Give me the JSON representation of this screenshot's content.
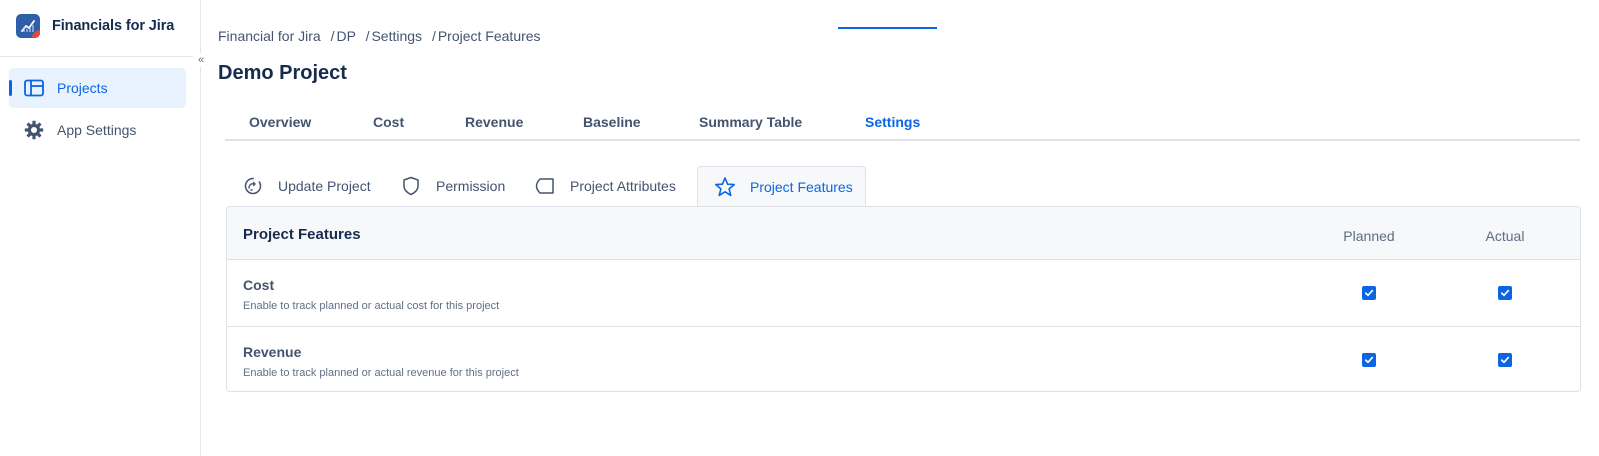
{
  "app": {
    "name": "Financials for Jira",
    "collapse_glyph": "«"
  },
  "sidebar": {
    "items": [
      {
        "label": "Projects",
        "icon": "board-icon",
        "active": true
      },
      {
        "label": "App Settings",
        "icon": "gear-icon",
        "active": false
      }
    ]
  },
  "breadcrumb": {
    "items": [
      "Financial for Jira",
      "DP",
      "Settings",
      "Project Features"
    ],
    "separator": "/"
  },
  "page": {
    "title": "Demo Project"
  },
  "tabs": {
    "items": [
      "Overview",
      "Cost",
      "Revenue",
      "Baseline",
      "Summary Table",
      "Settings"
    ],
    "active": "Settings"
  },
  "subtabs": {
    "items": [
      {
        "label": "Update Project",
        "icon": "update-icon"
      },
      {
        "label": "Permission",
        "icon": "shield-icon"
      },
      {
        "label": "Project Attributes",
        "icon": "tag-icon"
      },
      {
        "label": "Project Features",
        "icon": "star-icon"
      }
    ],
    "active": "Project Features"
  },
  "features": {
    "title": "Project Features",
    "columns": [
      "Planned",
      "Actual"
    ],
    "rows": [
      {
        "title": "Cost",
        "description": "Enable to track planned or actual cost for this project",
        "planned": true,
        "actual": true
      },
      {
        "title": "Revenue",
        "description": "Enable to track planned or actual revenue for this project",
        "planned": true,
        "actual": true
      }
    ]
  },
  "colors": {
    "accent": "#0c66e4",
    "active_bg": "#e9f2ff",
    "border": "#dfe1e6",
    "text": "#172b4d",
    "subtle_text": "#44546f"
  }
}
